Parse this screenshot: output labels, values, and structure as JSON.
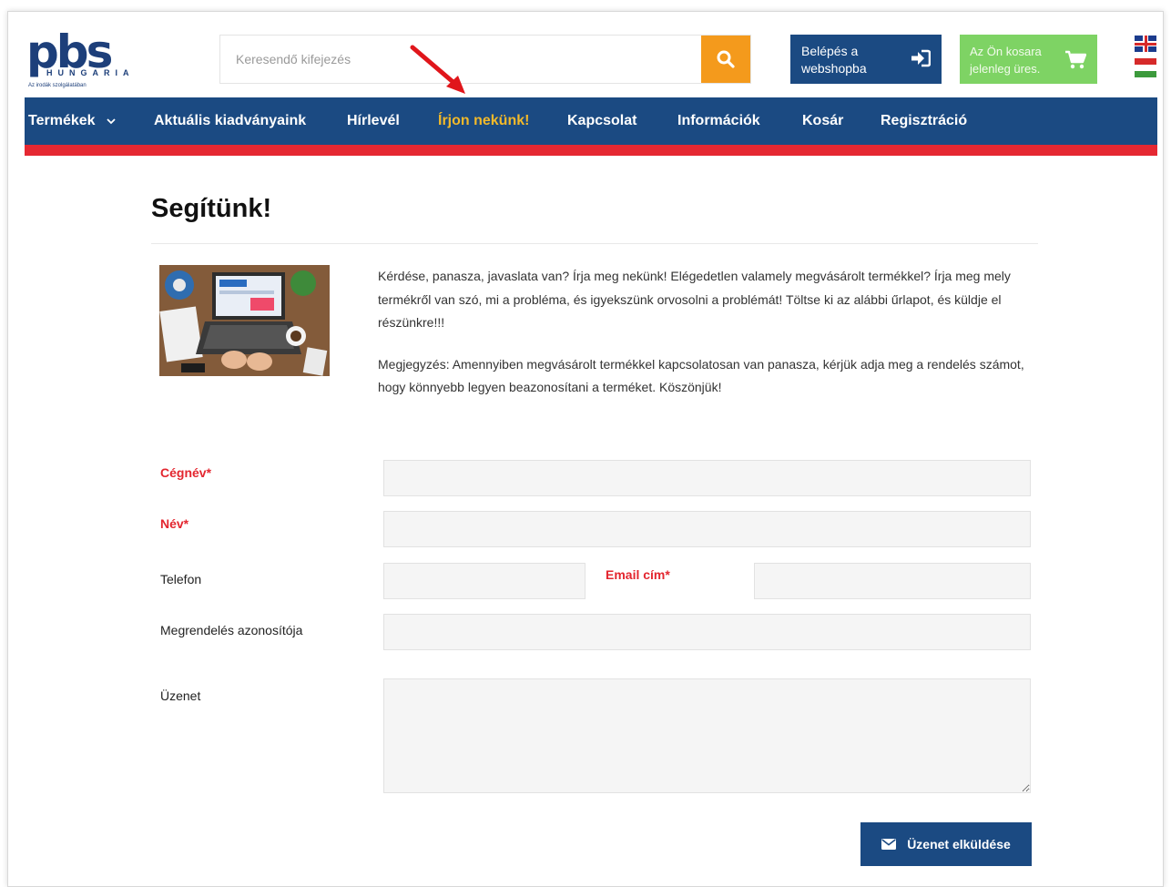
{
  "header": {
    "logo_text": "pbs",
    "logo_subtext": "HUNGARIA",
    "logo_tagline": "Az irodák szolgálatában",
    "search": {
      "placeholder": "Keresendő kifejezés",
      "button_icon": "search-icon"
    },
    "login_button": {
      "label": "Belépés a webshopba",
      "icon": "sign-in-icon"
    },
    "cart_button": {
      "label": "Az Ön kosara jelenleg üres.",
      "icon": "cart-icon"
    },
    "languages": [
      "english-flag-icon",
      "hungarian-flag-icon"
    ]
  },
  "nav": {
    "items": [
      {
        "label": "Termékek",
        "has_dropdown": true
      },
      {
        "label": "Aktuális kiadványaink"
      },
      {
        "label": "Hírlevél"
      },
      {
        "label": "Írjon nekünk!",
        "active": true
      },
      {
        "label": "Kapcsolat"
      },
      {
        "label": "Információk"
      },
      {
        "label": "Kosár"
      },
      {
        "label": "Regisztráció"
      }
    ]
  },
  "page": {
    "title": "Segítünk!",
    "intro_paragraph_1": "Kérdése, panasza, javaslata van? Írja meg nekünk! Elégedetlen valamely megvásárolt termékkel? Írja meg mely termékről van szó, mi a probléma, és igyekszünk orvosolni a problémát! Töltse ki az alábbi űrlapot, és küldje el részünkre!!!",
    "intro_paragraph_2": "Megjegyzés: Amennyiben megvásárolt termékkel kapcsolatosan van panasza, kérjük adja meg a rendelés számot, hogy könnyebb legyen beazonosítani a terméket. Köszönjük!"
  },
  "form": {
    "company_label": "Cégnév*",
    "name_label": "Név*",
    "phone_label": "Telefon",
    "email_label": "Email cím*",
    "order_id_label": "Megrendelés azonosítója",
    "message_label": "Üzenet",
    "company_value": "",
    "name_value": "",
    "phone_value": "",
    "email_value": "",
    "order_id_value": "",
    "message_value": "",
    "submit_label": "Üzenet elküldése"
  },
  "colors": {
    "brand_blue": "#1b4a82",
    "accent_red": "#e52832",
    "search_orange": "#f49a1c",
    "cart_green": "#7ed364",
    "active_nav": "#f2b92a",
    "required_label": "#e3262f",
    "annotation_arrow": "#e0161b"
  }
}
